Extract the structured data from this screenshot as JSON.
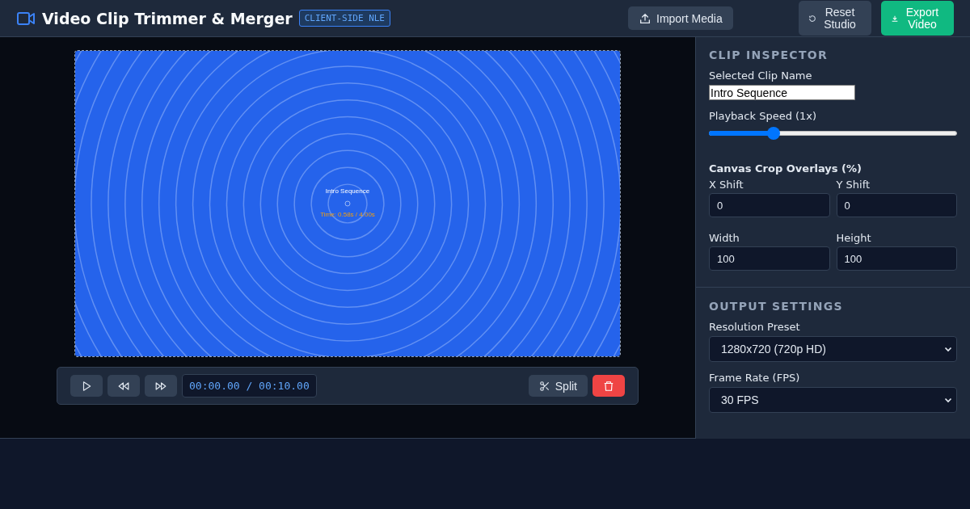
{
  "header": {
    "title": "Video Clip Trimmer & Merger",
    "badge": "CLIENT-SIDE NLE",
    "import_button": "Import Media",
    "reset_button": "Reset Studio",
    "export_button": "Export Video"
  },
  "preview": {
    "clip_label": "Intro Sequence",
    "time_label": "Time: 0.58s / 4.00s"
  },
  "transport": {
    "timecode": "00:00.00 / 00:10.00",
    "split_button": "Split"
  },
  "clip_inspector": {
    "title": "CLIP INSPECTOR",
    "name_label": "Selected Clip Name",
    "name_value": "Intro Sequence",
    "speed_label": "Playback Speed (1x)",
    "speed": {
      "level": 0.26
    },
    "crop_title": "Canvas Crop Overlays (%)",
    "crop_fields": [
      {
        "label": "X Shift",
        "value": "0"
      },
      {
        "label": "Y Shift",
        "value": "0"
      },
      {
        "label": "Width",
        "value": "100"
      },
      {
        "label": "Height",
        "value": "100"
      }
    ]
  },
  "output_settings": {
    "title": "OUTPUT SETTINGS",
    "fields": [
      {
        "label": "Resolution Preset",
        "value": "1280x720 (720p HD)"
      },
      {
        "label": "Frame Rate (FPS)",
        "value": "30 FPS"
      }
    ]
  }
}
